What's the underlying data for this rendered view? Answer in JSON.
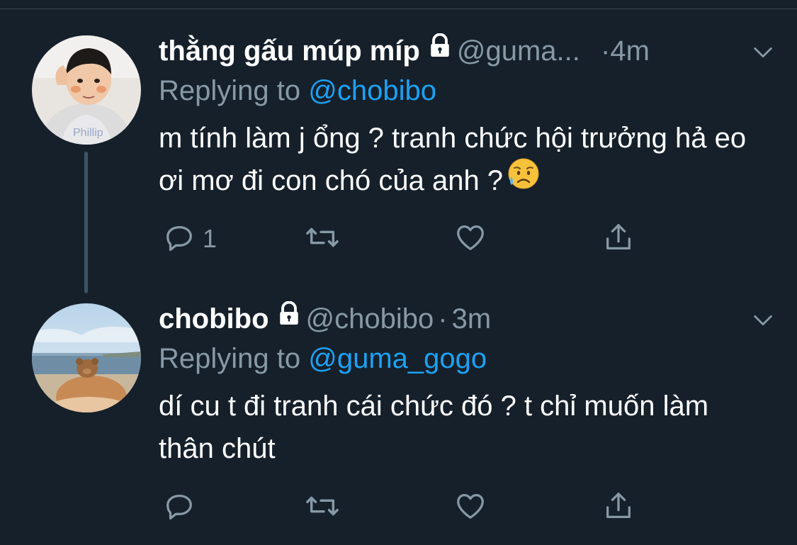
{
  "tweets": [
    {
      "name": "thằng gấu múp míp",
      "handle": "@guma...",
      "dot": "·",
      "time": "4m",
      "replying_label": "Replying to ",
      "replying_to": "@chobibo",
      "text": "m tính làm j ổng ? tranh chức hội trưởng hả eo ơi mơ đi con chó của anh ?",
      "emoji": "sad-but-relieved-face-emoji",
      "reply_count": "1",
      "avatar": "child-photo-avatar"
    },
    {
      "name": "chobibo",
      "handle": "@chobibo",
      "dot": "·",
      "time": "3m",
      "replying_label": "Replying to ",
      "replying_to": "@guma_gogo",
      "text": "dí cu t đi tranh cái chức đó ? t chỉ muốn làm thân chút",
      "reply_count": "",
      "avatar": "beach-teddy-bear-avatar"
    }
  ],
  "icons": {
    "protected": "lock-icon",
    "more": "chevron-down-icon",
    "reply": "reply-icon",
    "retweet": "retweet-icon",
    "like": "heart-icon",
    "share": "share-icon"
  },
  "colors": {
    "background": "#15202b",
    "secondary_text": "#8899a6",
    "link": "#1da1f2",
    "thread_line": "#3d5466"
  }
}
